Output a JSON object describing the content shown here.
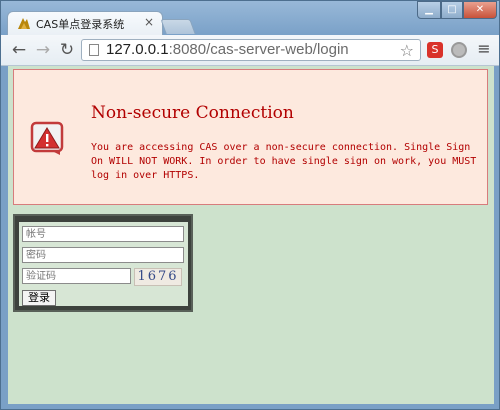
{
  "browser": {
    "tab_title": "CAS单点登录系统",
    "tab_close": "×",
    "url_host": "127.0.0.1",
    "url_rest": ":8080/cas-server-web/login",
    "ext_label": "S"
  },
  "warning": {
    "title": "Non-secure Connection",
    "message": "You are accessing CAS over a non-secure connection. Single Sign On WILL NOT WORK. In order to have single sign on work, you MUST log in over HTTPS.",
    "accent_color": "#b20000",
    "background": "#fde9de"
  },
  "login": {
    "username_placeholder": "帐号",
    "password_placeholder": "密码",
    "captcha_placeholder": "验证码",
    "captcha_text": "1676",
    "submit_label": "登录"
  }
}
